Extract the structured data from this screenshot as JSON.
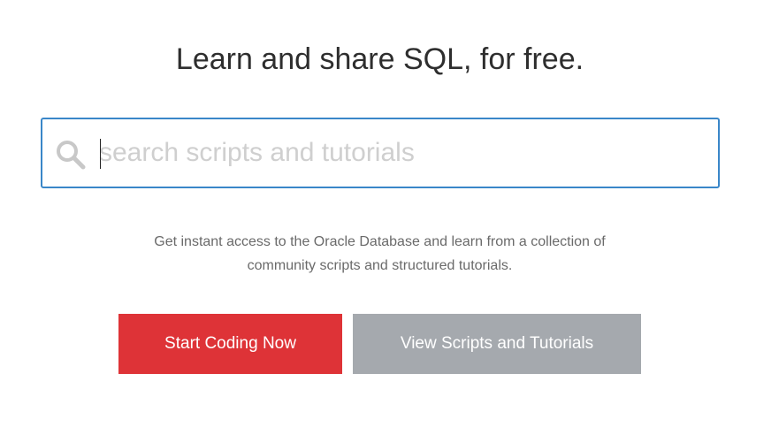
{
  "hero": {
    "title": "Learn and share SQL, for free."
  },
  "search": {
    "icon": "search-icon",
    "placeholder": "search scripts and tutorials",
    "value": "",
    "border_color": "#3a87c9"
  },
  "description": {
    "line1": "Get instant access to the Oracle Database and learn from a collection of",
    "line2": "community scripts and structured tutorials."
  },
  "actions": {
    "primary_label": "Start Coding Now",
    "primary_color": "#de3337",
    "secondary_label": "View Scripts and Tutorials",
    "secondary_color": "#a5a9ae"
  }
}
